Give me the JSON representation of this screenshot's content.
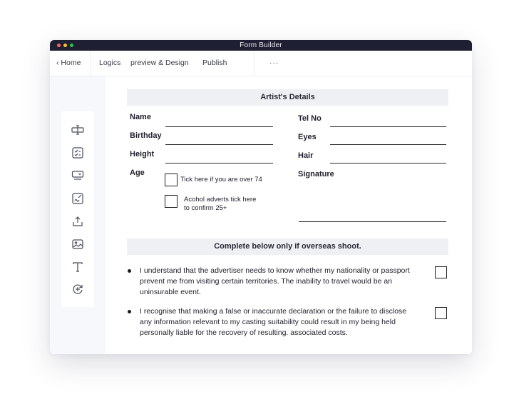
{
  "window": {
    "title": "Form Builder"
  },
  "nav": {
    "home": "‹ Home",
    "logics": "Logics",
    "preview_design": "preview & Design",
    "publish": "Publish",
    "more": "···"
  },
  "toolbar": {
    "icons": [
      "text-field-icon",
      "checklist-icon",
      "dropdown-icon",
      "signature-icon",
      "upload-icon",
      "image-icon",
      "text-icon",
      "calculation-icon"
    ]
  },
  "form": {
    "section1_title": "Artist's Details",
    "left_fields": {
      "name": "Name",
      "birthday": "Birthday",
      "height": "Height",
      "age": "Age"
    },
    "right_fields": {
      "tel": "Tel No",
      "eyes": "Eyes",
      "hair": "Hair",
      "signature": "Signature"
    },
    "age_checkbox_1": "Tick here if you are over 74",
    "age_checkbox_2_line1": "Acohol adverts tick here",
    "age_checkbox_2_line2": "to confirm 25+",
    "section2_title": "Complete below only if overseas shoot.",
    "statement1": "I understand that the advertiser needs to know whether my nationality or passport prevent me from visiting certain territories. The inability to travel would be an uninsurable event.",
    "statement2": "I recognise that making a false or inaccurate declaration or the failure to disclose any information relevant to my casting suitability could result in my being held personally liable for the recovery of resulting. associated costs."
  }
}
